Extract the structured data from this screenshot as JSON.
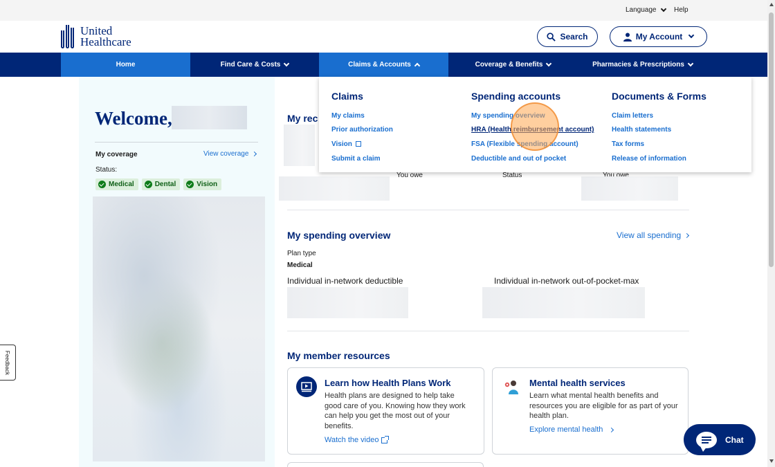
{
  "utility": {
    "language": "Language",
    "help": "Help"
  },
  "header": {
    "brand_line1": "United",
    "brand_line2": "Healthcare",
    "search_label": "Search",
    "account_label": "My Account"
  },
  "nav": {
    "items": [
      {
        "label": "Home"
      },
      {
        "label": "Find Care & Costs"
      },
      {
        "label": "Claims & Accounts"
      },
      {
        "label": "Coverage & Benefits"
      },
      {
        "label": "Pharmacies & Prescriptions"
      }
    ],
    "active": "Claims & Accounts"
  },
  "dropdown": {
    "claims": {
      "heading": "Claims",
      "links": [
        "My claims",
        "Prior authorization",
        "Vision",
        "Submit a claim"
      ]
    },
    "spending": {
      "heading": "Spending accounts",
      "links": [
        "My spending overview",
        "HRA (Health reimbursement account)",
        "FSA (Flexible spending account)",
        "Deductible and out of pocket"
      ]
    },
    "documents": {
      "heading": "Documents & Forms",
      "links": [
        "Claim letters",
        "Health statements",
        "Tax forms",
        "Release of information"
      ]
    }
  },
  "sidebar": {
    "welcome": "Welcome,",
    "my_coverage": "My coverage",
    "view_coverage": "View coverage",
    "status_label": "Status:",
    "badges": [
      "Medical",
      "Dental",
      "Vision"
    ]
  },
  "main": {
    "recent_title": "My rec",
    "you_owe": "You owe",
    "status": "Status",
    "you_owe_2": "You owe",
    "spending_title": "My spending overview",
    "view_all_spending": "View all spending",
    "plan_type_label": "Plan type",
    "plan_type_value": "Medical",
    "deductible_label": "Individual in-network deductible",
    "oop_label": "Individual in-network out-of-pocket-max",
    "resources_title": "My member resources",
    "cards": [
      {
        "title": "Learn how Health Plans Work",
        "body": "Health plans are designed to help take good care of you. Knowing how they work can help you get the most out of your benefits.",
        "link": "Watch the video"
      },
      {
        "title": "Mental health services",
        "body": "Learn what mental health benefits and resources you are eligible for as part of your health plan.",
        "link": "Explore mental health"
      }
    ]
  },
  "feedback_label": "Feedback",
  "chat_label": "Chat",
  "colors": {
    "navy": "#002677",
    "blue": "#196ecf",
    "green_badge": "#dcefdc"
  }
}
